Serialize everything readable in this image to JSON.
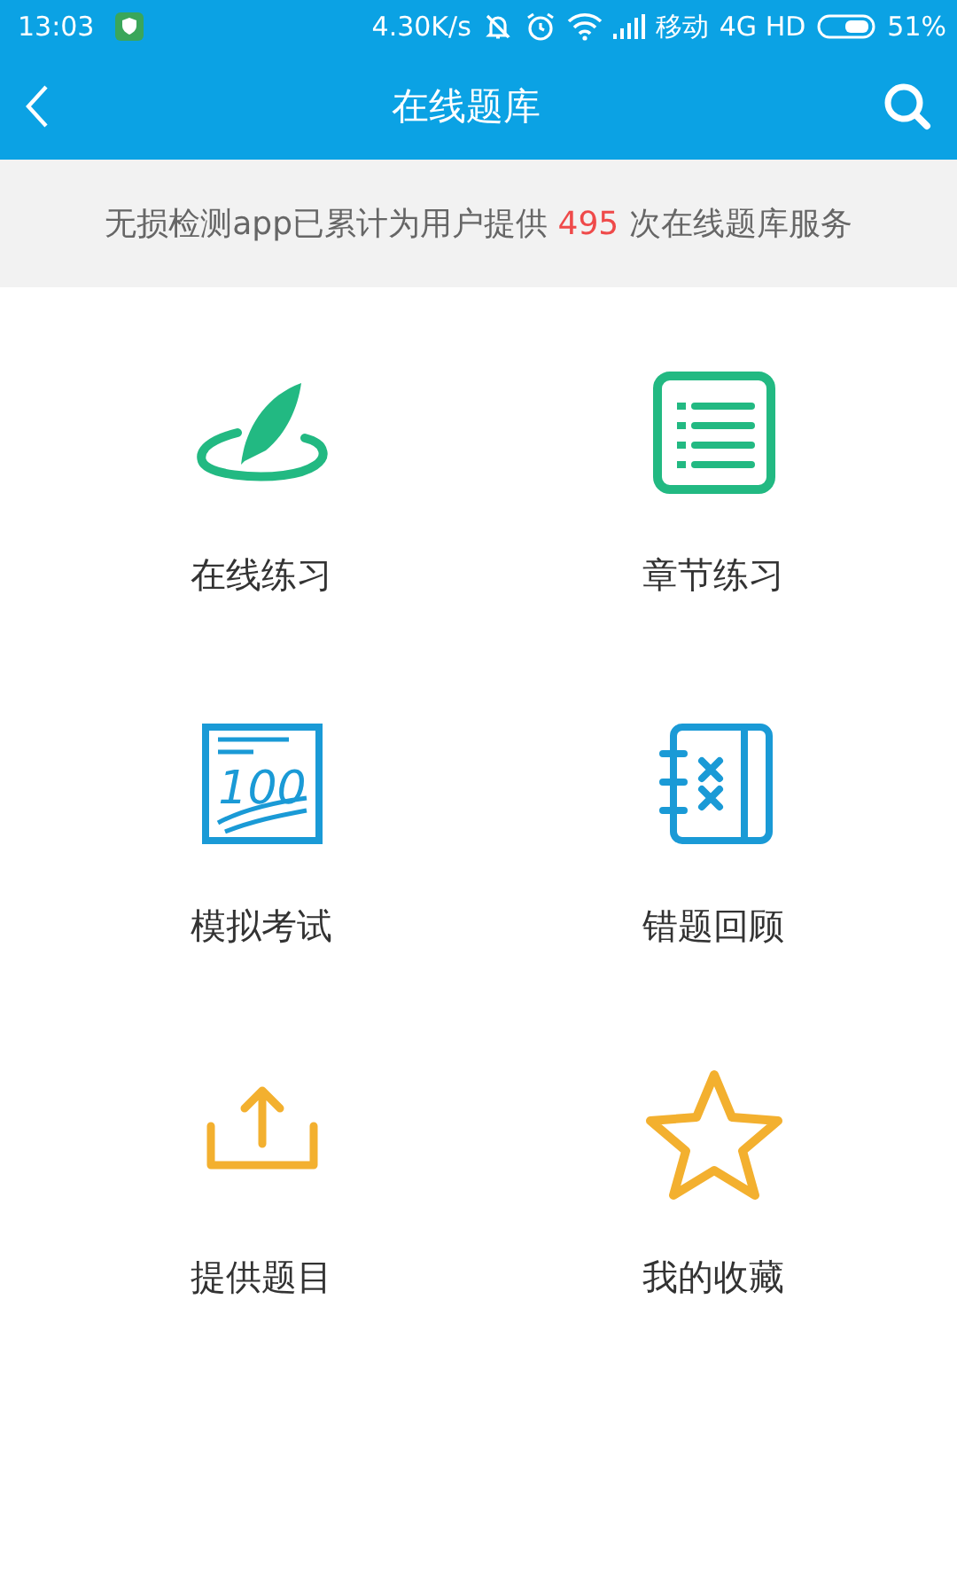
{
  "status_bar": {
    "time": "13:03",
    "speed": "4.30K/s",
    "carrier": "移动",
    "network": "4G HD",
    "battery": "51%"
  },
  "header": {
    "title": "在线题库"
  },
  "banner": {
    "prefix": "无损检测app已累计为用户提供",
    "count": "495",
    "suffix": "次在线题库服务"
  },
  "tiles": [
    {
      "label": "在线练习",
      "kind": "feather"
    },
    {
      "label": "章节练习",
      "kind": "list"
    },
    {
      "label": "模拟考试",
      "kind": "exam",
      "icon_text": "100"
    },
    {
      "label": "错题回顾",
      "kind": "notebook"
    },
    {
      "label": "提供题目",
      "kind": "upload"
    },
    {
      "label": "我的收藏",
      "kind": "star"
    }
  ]
}
